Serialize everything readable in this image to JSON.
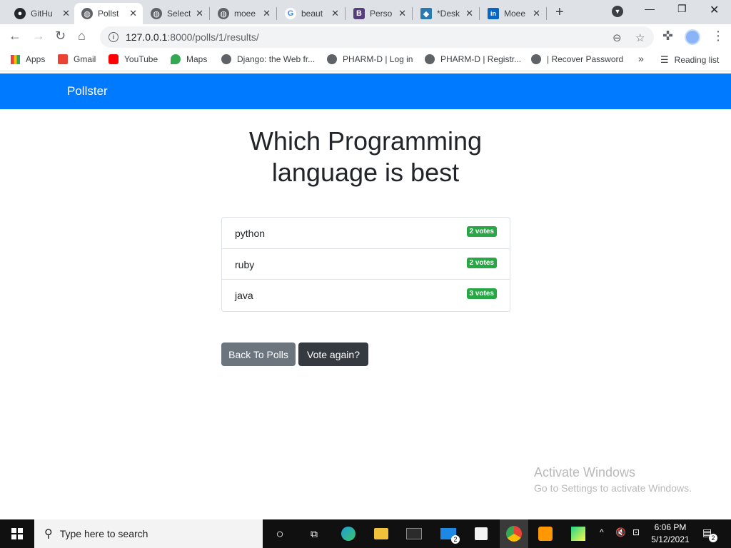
{
  "browser": {
    "tabs": [
      {
        "title": "GitHu",
        "icon": "github-icon",
        "color": "#24292e"
      },
      {
        "title": "Pollst",
        "icon": "globe-icon",
        "color": "#5f6368",
        "active": true
      },
      {
        "title": "Select",
        "icon": "globe-icon",
        "color": "#5f6368"
      },
      {
        "title": "moee",
        "icon": "globe-icon",
        "color": "#5f6368"
      },
      {
        "title": "beaut",
        "icon": "google-icon",
        "color": "#4285f4"
      },
      {
        "title": "Perso",
        "icon": "bootstrap-icon",
        "color": "#563d7c"
      },
      {
        "title": "*Desk",
        "icon": "design-icon",
        "color": "#2a7ab0"
      },
      {
        "title": "Moee",
        "icon": "linkedin-icon",
        "color": "#0a66c2"
      }
    ],
    "new_tab": "+",
    "url_host": "127.0.0.1",
    "url_path": ":8000/polls/1/results/",
    "bookmarks": [
      {
        "label": "Apps",
        "icon": "apps-grid-icon"
      },
      {
        "label": "Gmail",
        "icon": "gmail-icon"
      },
      {
        "label": "YouTube",
        "icon": "youtube-icon"
      },
      {
        "label": "Maps",
        "icon": "maps-icon"
      },
      {
        "label": "Django: the Web fr...",
        "icon": "globe-icon"
      },
      {
        "label": "PHARM-D | Log in",
        "icon": "globe-icon"
      },
      {
        "label": "PHARM-D | Registr...",
        "icon": "globe-icon"
      },
      {
        "label": "| Recover Password",
        "icon": "globe-icon"
      }
    ],
    "more_bookmarks": "»",
    "reading_list": "Reading list"
  },
  "page": {
    "brand": "Pollster",
    "question": "Which Programming language is best",
    "choices": [
      {
        "name": "python",
        "votes": "2 votes"
      },
      {
        "name": "ruby",
        "votes": "2 votes"
      },
      {
        "name": "java",
        "votes": "3 votes"
      }
    ],
    "back_button": "Back To Polls",
    "vote_button": "Vote again?",
    "watermark_title": "Activate Windows",
    "watermark_sub": "Go to Settings to activate Windows."
  },
  "taskbar": {
    "search_placeholder": "Type here to search",
    "time": "6:06 PM",
    "date": "5/12/2021",
    "mail_badge": "2",
    "notif_badge": "2"
  },
  "colors": {
    "navbar": "#007bff",
    "badge": "#28a745",
    "back_button": "#6c757d",
    "vote_button": "#343a40"
  }
}
